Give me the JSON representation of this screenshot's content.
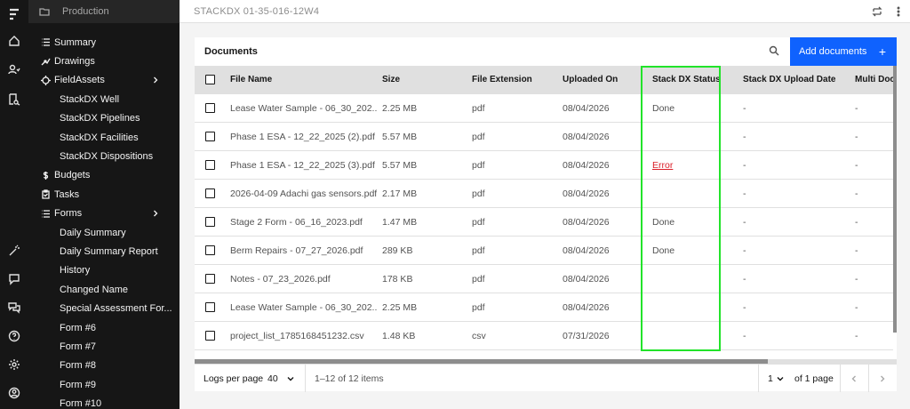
{
  "sidebar": {
    "context": "Production",
    "items": [
      {
        "label": "Summary",
        "icon": "list-icon"
      },
      {
        "label": "Drawings",
        "icon": "drawings-icon"
      },
      {
        "label": "FieldAssets",
        "icon": "crosshair-icon",
        "expandable": true
      },
      {
        "label": "StackDX Well",
        "sub": true
      },
      {
        "label": "StackDX Pipelines",
        "sub": true
      },
      {
        "label": "StackDX Facilities",
        "sub": true
      },
      {
        "label": "StackDX Dispositions",
        "sub": true
      },
      {
        "label": "Budgets",
        "icon": "dollar-icon"
      },
      {
        "label": "Tasks",
        "icon": "clipboard-icon"
      },
      {
        "label": "Forms",
        "icon": "list-icon",
        "expandable": true
      },
      {
        "label": "Daily Summary",
        "sub": true
      },
      {
        "label": "Daily Summary Report",
        "sub": true
      },
      {
        "label": "History",
        "sub": true
      },
      {
        "label": "Changed Name",
        "sub": true
      },
      {
        "label": "Special Assessment For...",
        "sub": true
      },
      {
        "label": "Form #6",
        "sub": true
      },
      {
        "label": "Form #7",
        "sub": true
      },
      {
        "label": "Form #8",
        "sub": true
      },
      {
        "label": "Form #9",
        "sub": true
      },
      {
        "label": "Form #10",
        "sub": true
      }
    ]
  },
  "topbar": {
    "breadcrumb": "STACKDX 01-35-016-12W4"
  },
  "documents": {
    "title": "Documents",
    "add_label": "Add documents",
    "add_plus": "+",
    "columns": [
      "File Name",
      "Size",
      "File Extension",
      "Uploaded On",
      "Stack DX Status",
      "Stack DX Upload Date",
      "Multi Docu"
    ],
    "rows": [
      {
        "name": "Lease Water Sample - 06_30_202...",
        "size": "2.25 MB",
        "ext": "pdf",
        "uploaded": "08/04/2026",
        "status": "Done",
        "upload_date": "-",
        "multi": "-"
      },
      {
        "name": "Phase 1 ESA - 12_22_2025 (2).pdf",
        "size": "5.57 MB",
        "ext": "pdf",
        "uploaded": "08/04/2026",
        "status": "",
        "upload_date": "-",
        "multi": "-"
      },
      {
        "name": "Phase 1 ESA - 12_22_2025 (3).pdf",
        "size": "5.57 MB",
        "ext": "pdf",
        "uploaded": "08/04/2026",
        "status": "Error",
        "upload_date": "-",
        "multi": "-"
      },
      {
        "name": "2026-04-09 Adachi gas sensors.pdf",
        "size": "2.17 MB",
        "ext": "pdf",
        "uploaded": "08/04/2026",
        "status": "",
        "upload_date": "-",
        "multi": "-"
      },
      {
        "name": "Stage 2 Form - 06_16_2023.pdf",
        "size": "1.47 MB",
        "ext": "pdf",
        "uploaded": "08/04/2026",
        "status": "Done",
        "upload_date": "-",
        "multi": "-"
      },
      {
        "name": "Berm Repairs - 07_27_2026.pdf",
        "size": "289 KB",
        "ext": "pdf",
        "uploaded": "08/04/2026",
        "status": "Done",
        "upload_date": "-",
        "multi": "-"
      },
      {
        "name": "Notes - 07_23_2026.pdf",
        "size": "178 KB",
        "ext": "pdf",
        "uploaded": "08/04/2026",
        "status": "",
        "upload_date": "-",
        "multi": "-"
      },
      {
        "name": "Lease Water Sample - 06_30_202...",
        "size": "2.25 MB",
        "ext": "pdf",
        "uploaded": "08/04/2026",
        "status": "",
        "upload_date": "-",
        "multi": "-"
      },
      {
        "name": "project_list_1785168451232.csv",
        "size": "1.48 KB",
        "ext": "csv",
        "uploaded": "07/31/2026",
        "status": "",
        "upload_date": "-",
        "multi": "-"
      }
    ]
  },
  "pagination": {
    "per_page_label": "Logs per page",
    "per_page": "40",
    "items_text": "1–12 of 12 items",
    "page": "1",
    "of_pages": "of 1 page"
  },
  "colors": {
    "primary": "#0f62fe",
    "error": "#da1e28",
    "highlight": "#22e32a",
    "sidebar_bg": "#161616"
  }
}
